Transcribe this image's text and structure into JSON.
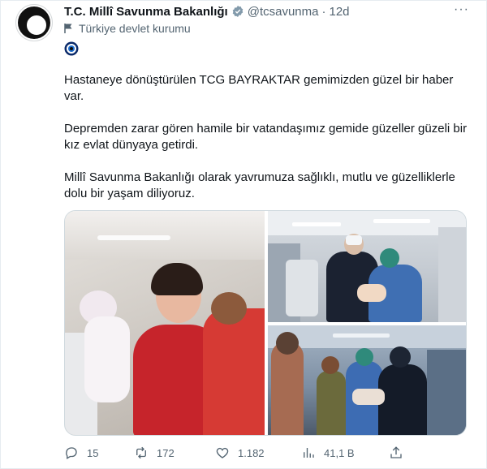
{
  "tweet": {
    "author_name": "T.C. Millî Savunma Bakanlığı",
    "handle": "@tcsavunma",
    "separator": "·",
    "time": "12d",
    "affiliation": "Türkiye devlet kurumu",
    "text": [
      "Hastaneye dönüştürülen TCG BAYRAKTAR gemimizden güzel bir haber var.",
      "Depremden zarar gören hamile bir vatandaşımız gemide güzeller güzeli bir kız evlat dünyaya getirdi.",
      "Millî Savunma Bakanlığı olarak yavrumuza sağlıklı, mutlu ve güzelliklerle dolu bir yaşam diliyoruz."
    ],
    "more_label": "···"
  },
  "metrics": {
    "replies": "15",
    "retweets": "172",
    "likes": "1.182",
    "views": "41,1 B"
  },
  "colors": {
    "text_primary": "#0f1419",
    "text_secondary": "#536471",
    "verified": "#829aab",
    "border": "#cfd9de"
  },
  "icons": {
    "verified": "verified-badge-icon",
    "affiliation": "flag-icon",
    "eye_badge": "nazar-badge-icon",
    "reply": "reply-icon",
    "retweet": "retweet-icon",
    "like": "heart-icon",
    "views": "views-icon",
    "share": "share-icon",
    "more": "more-icon"
  }
}
